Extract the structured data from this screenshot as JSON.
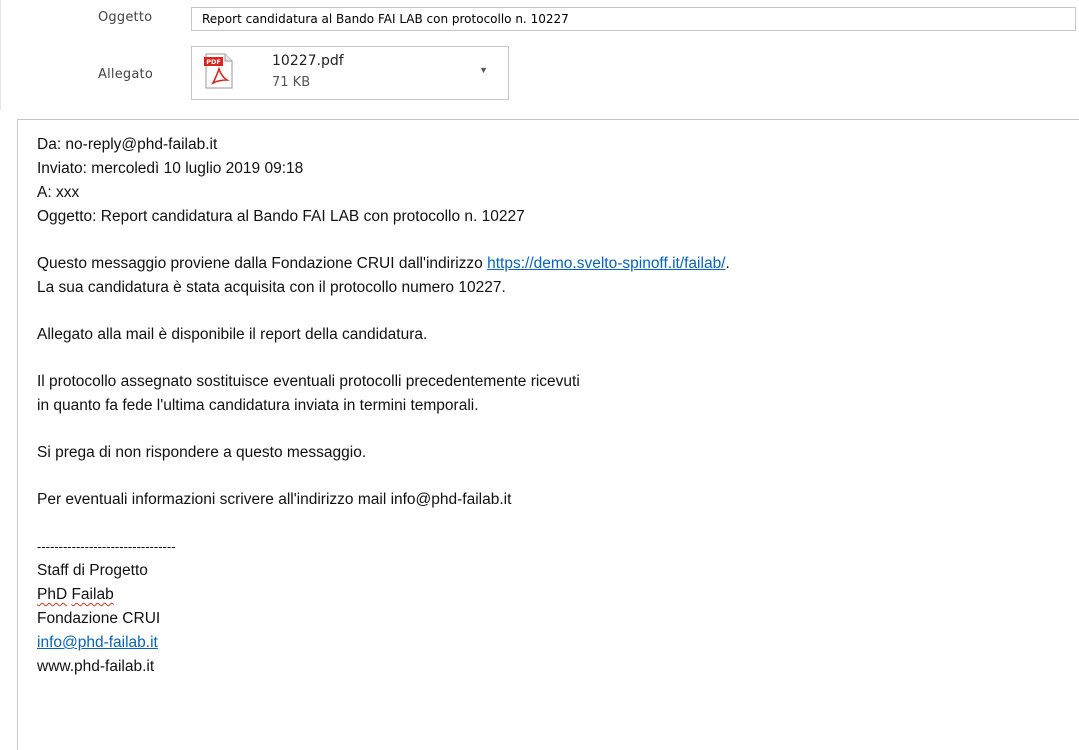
{
  "header": {
    "subject_label": "Oggetto",
    "subject_value": "Report candidatura al Bando FAI LAB con protocollo n. 10227",
    "attachment_label": "Allegato",
    "attachment": {
      "icon": "pdf-file-icon",
      "icon_badge": "PDF",
      "name": "10227.pdf",
      "size": "71 KB"
    }
  },
  "email": {
    "from": "Da: no-reply@phd-failab.it",
    "sent": "Inviato: mercoledì 10 luglio 2019 09:18",
    "to": "A: xxx",
    "subject": "Oggetto: Report candidatura al Bando FAI LAB con protocollo n. 10227",
    "p1_prefix": "Questo messaggio proviene dalla Fondazione CRUI dall'indirizzo ",
    "p1_link": "https://demo.svelto-spinoff.it/failab/",
    "p1_suffix": ".",
    "p1_line2": "La sua candidatura è stata acquisita con il protocollo numero 10227.",
    "p2": "Allegato alla mail è disponibile il report della candidatura.",
    "p3_line1": "Il protocollo assegnato sostituisce eventuali protocolli precedentemente ricevuti",
    "p3_line2": "in quanto fa fede l'ultima candidatura inviata  in termini temporali.",
    "p4": "Si prega di non rispondere a questo messaggio.",
    "p5": "Per eventuali informazioni scrivere all'indirizzo mail info@phd-failab.it",
    "signature": {
      "separator": "--------------------------------",
      "line1": "Staff di Progetto",
      "line2_word1": "PhD",
      "line2_word2": "Failab",
      "line3": "Fondazione CRUI",
      "email": "info@phd-failab.it",
      "website": "www.phd-failab.it"
    }
  },
  "colors": {
    "link": "#0563c1",
    "border": "#c6c6c6",
    "pdf_red": "#d9261c",
    "spellcheck": "#d8331f"
  }
}
